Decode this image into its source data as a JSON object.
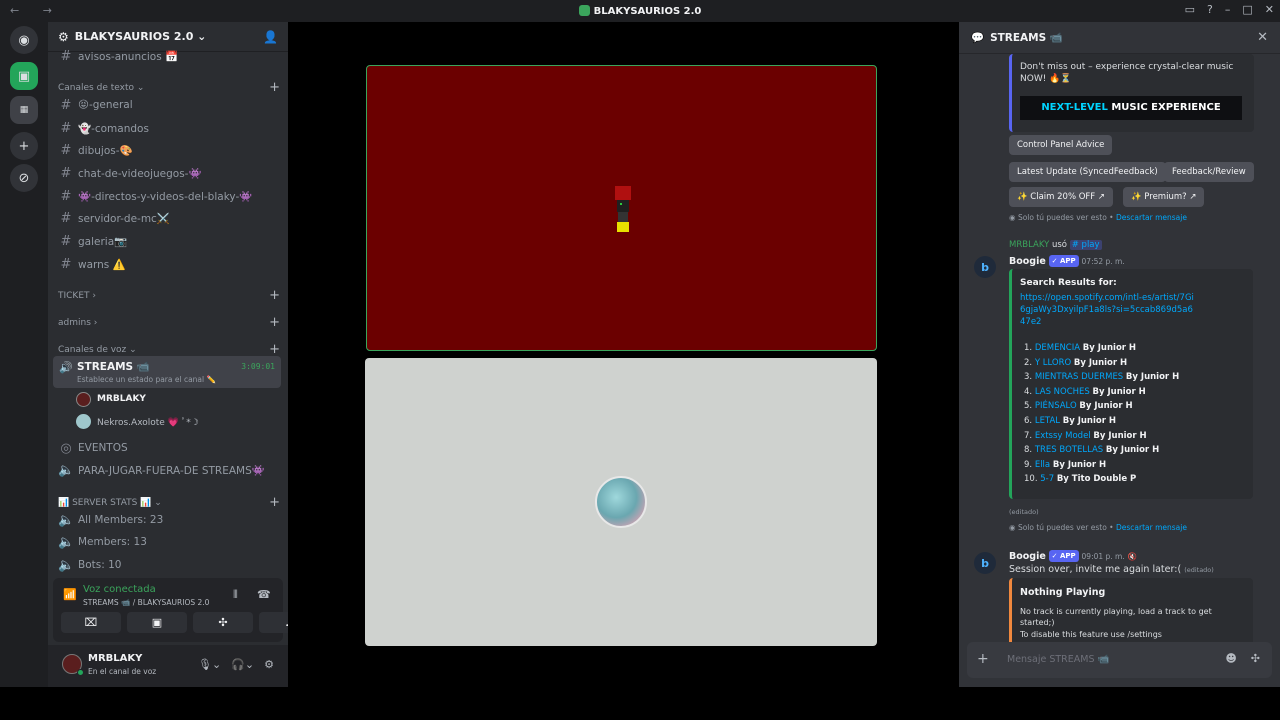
{
  "window": {
    "title": "BLAKYSAURIOS 2.0",
    "nav": "← →"
  },
  "server": {
    "name": "BLAKYSAURIOS 2.0",
    "top_channel": "avisos-anuncios 📅",
    "categories": {
      "texto": "Canales de texto",
      "ticket": "TICKET",
      "admins": "admins",
      "voz": "Canales de voz",
      "stats": "📊 SERVER STATS 📊"
    },
    "text_channels": [
      "😝-general",
      "👻-comandos",
      "dibujos-🎨",
      "chat-de-videojuegos-👾",
      "👾-directos-y-videos-del-blaky-👾",
      "servidor-de-mc⚔️",
      "galeria📷",
      "warns ⚠️"
    ],
    "voice_active": {
      "name": "STREAMS 📹",
      "status": "Establece un estado para el canal ✏️",
      "timer": "3:09:01"
    },
    "voice_users": [
      "MRBLAKY",
      "Nekros.Axolote 💗 ﾟ*☽"
    ],
    "voice_channels": [
      "EVENTOS",
      "PARA-JUGAR-FUERA-DE STREAMS👾"
    ],
    "stats": [
      "All Members: 23",
      "Members: 13",
      "Bots: 10"
    ]
  },
  "voice_panel": {
    "state": "Voz conectada",
    "location": "STREAMS 📹 / BLAKYSAURIOS 2.0"
  },
  "user": {
    "name": "MRBLAKY",
    "status": "En el canal de voz"
  },
  "chat": {
    "header": "STREAMS 📹",
    "promo_text": "Don't miss out – experience crystal-clear music NOW! 🔥⏳",
    "promo_banner_a": "NEXT-LEVEL",
    "promo_banner_b": "MUSIC EXPERIENCE",
    "buttons": [
      "Control Panel Advice",
      "Latest Update (SyncedFeedback)",
      "Feedback/Review",
      "✨ Claim 20% OFF ↗",
      "✨ Premium? ↗"
    ],
    "ephemeral": "Solo tú puedes ver esto •",
    "dismiss": "Descartar mensaje",
    "edited": "(editado)",
    "reply_user": "MRBLAKY",
    "reply_used": "usó",
    "reply_cmd": "# play",
    "bot_name": "Boogie",
    "app_badge": "✓ APP",
    "msg1_time": "07:52 p. m.",
    "search_title": "Search Results for:",
    "search_url": "https://open.spotify.com/intl-es/artist/7Gi6gjaWy3DxyilpF1a8ls?si=5ccab869d5a647e2",
    "tracks": [
      {
        "n": "1.",
        "title": "DEMENCIA",
        "by": "By Junior H"
      },
      {
        "n": "2.",
        "title": "Y LLORO",
        "by": "By Junior H"
      },
      {
        "n": "3.",
        "title": "MIENTRAS DUERMES",
        "by": "By Junior H"
      },
      {
        "n": "4.",
        "title": "LAS NOCHES",
        "by": "By Junior H"
      },
      {
        "n": "5.",
        "title": "PIÉNSALO",
        "by": "By Junior H"
      },
      {
        "n": "6.",
        "title": "LETAL",
        "by": "By Junior H"
      },
      {
        "n": "7.",
        "title": "Extssy Model",
        "by": "By Junior H"
      },
      {
        "n": "8.",
        "title": "TRES BOTELLAS",
        "by": "By Junior H"
      },
      {
        "n": "9.",
        "title": "Ella",
        "by": "By Junior H"
      },
      {
        "n": "10.",
        "title": "5-7",
        "by": "By Tito Double P"
      }
    ],
    "msg2_time": "09:01 p. m.",
    "msg2_text": "Session over, invite me again later:(",
    "np_title": "Nothing Playing",
    "np_text": "No track is currently playing, load a track to get started;)",
    "np_hint": "To disable this feature use /settings",
    "composer_placeholder": "Mensaje STREAMS 📹"
  },
  "colors": {
    "accent_green": "#3ba55c",
    "blurple": "#5865f2",
    "link": "#00a8fc",
    "embed_bar_green": "#23a55a",
    "embed_bar_orange": "#f0883e",
    "stream_tile_red": "#6b0000"
  }
}
